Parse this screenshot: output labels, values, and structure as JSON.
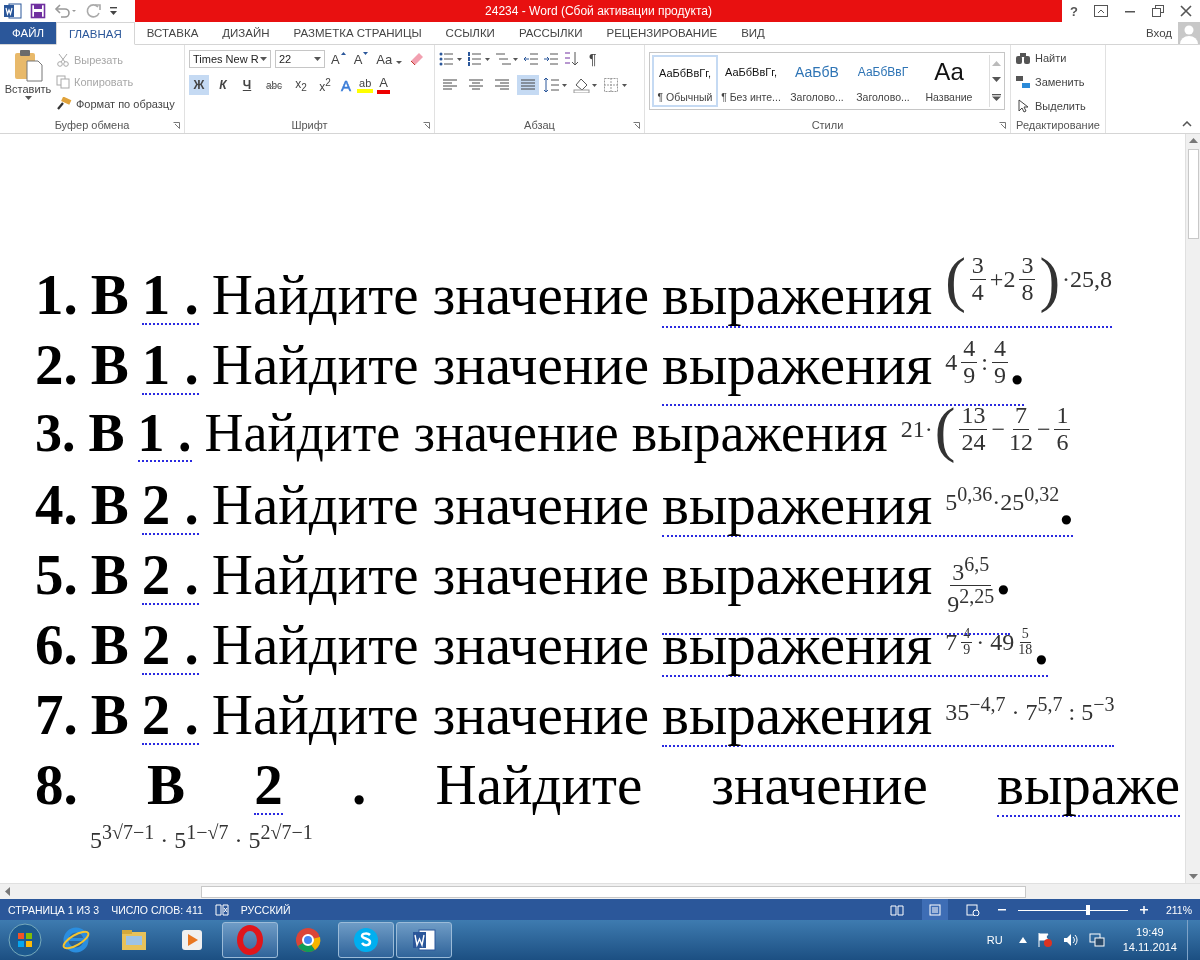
{
  "title_bar": {
    "title": "24234 -  Word (Сбой активации продукта)",
    "help": "?"
  },
  "tabs": [
    {
      "label": "ФАЙЛ",
      "kind": "file",
      "selected": false
    },
    {
      "label": "ГЛАВНАЯ",
      "kind": "tab",
      "selected": true
    },
    {
      "label": "ВСТАВКА",
      "kind": "tab",
      "selected": false
    },
    {
      "label": "ДИЗАЙН",
      "kind": "tab",
      "selected": false
    },
    {
      "label": "РАЗМЕТКА СТРАНИЦЫ",
      "kind": "tab",
      "selected": false
    },
    {
      "label": "ССЫЛКИ",
      "kind": "tab",
      "selected": false
    },
    {
      "label": "РАССЫЛКИ",
      "kind": "tab",
      "selected": false
    },
    {
      "label": "РЕЦЕНЗИРОВАНИЕ",
      "kind": "tab",
      "selected": false
    },
    {
      "label": "ВИД",
      "kind": "tab",
      "selected": false
    }
  ],
  "account": "Вход",
  "ribbon": {
    "clipboard": {
      "paste": "Вставить",
      "items": [
        {
          "label": "Вырезать",
          "disabled": true
        },
        {
          "label": "Копировать",
          "disabled": true
        },
        {
          "label": "Формат по образцу",
          "disabled": false
        }
      ],
      "label": "Буфер обмена"
    },
    "font": {
      "family": "Times New R",
      "size": "22",
      "grow": "A",
      "shrink": "A",
      "case": "Aa",
      "buttons": [
        {
          "text": "Ж",
          "kind": "bold",
          "selected": true
        },
        {
          "text": "К",
          "kind": "italic",
          "selected": false
        },
        {
          "text": "Ч",
          "kind": "underline",
          "selected": false
        },
        {
          "text": "abc",
          "kind": "strike",
          "selected": false
        },
        {
          "text": "x$_{2}$",
          "kind": "sub",
          "selected": false
        },
        {
          "text": "x$^{2}$",
          "kind": "sup",
          "selected": false
        }
      ],
      "effects": "A",
      "highlight": "ab",
      "color_text": "A",
      "label": "Шрифт"
    },
    "paragraph": {
      "pilcrow": "¶",
      "align": [
        {
          "kind": "left",
          "selected": false
        },
        {
          "kind": "center",
          "selected": false
        },
        {
          "kind": "right",
          "selected": false
        },
        {
          "kind": "justify",
          "selected": true
        }
      ],
      "label": "Абзац"
    },
    "styles": {
      "items": [
        {
          "sample": "АаБбВвГг,",
          "name": "¶ Обычный",
          "kind": "normal",
          "selected": true
        },
        {
          "sample": "АаБбВвГг,",
          "name": "¶ Без инте...",
          "kind": "normal",
          "selected": false
        },
        {
          "sample": "АаБбВ",
          "name": "Заголово...",
          "kind": "heading1",
          "selected": false
        },
        {
          "sample": "АаБбВвГ",
          "name": "Заголово...",
          "kind": "heading2",
          "selected": false
        },
        {
          "sample": "Аа",
          "name": "Название",
          "kind": "title",
          "selected": false
        }
      ],
      "label": "Стили"
    },
    "editing": {
      "items": [
        {
          "label": "Найти",
          "kind": "find"
        },
        {
          "label": "Заменить",
          "kind": "replace"
        },
        {
          "label": "Выделить",
          "kind": "select"
        }
      ],
      "label": "Редактирование"
    }
  },
  "document": {
    "items": [
      {
        "kind": "line",
        "number": "1.",
        "letter": "В",
        "task": "1",
        "dot": ".",
        "phrase": "Найдите значение",
        "word": "выражения",
        "flagged": true,
        "expr": [
          {
            "kind": "paren",
            "text": "("
          },
          {
            "kind": "frac",
            "num": "3",
            "den": "4"
          },
          {
            "kind": "text",
            "text": "+2"
          },
          {
            "kind": "frac",
            "num": "3",
            "den": "8"
          },
          {
            "kind": "paren",
            "text": ")"
          },
          {
            "kind": "text",
            "text": "·25,8"
          }
        ]
      },
      {
        "kind": "line",
        "number": "2.",
        "letter": "В",
        "task": "1",
        "dot": ".",
        "phrase": "Найдите значение",
        "word": "выражения",
        "flagged": true,
        "expr": [
          {
            "kind": "text",
            "text": "4"
          },
          {
            "kind": "frac",
            "num": "4",
            "den": "9"
          },
          {
            "kind": "text",
            "text": " : "
          },
          {
            "kind": "frac",
            "num": "4",
            "den": "9"
          }
        ],
        "end": "."
      },
      {
        "kind": "line",
        "number": "3.",
        "letter": "В",
        "task": "1",
        "dot": ".",
        "phrase": "Найдите значение",
        "word": "выражения",
        "flagged": false,
        "expr": [
          {
            "kind": "text",
            "text": "21·"
          },
          {
            "kind": "paren",
            "text": "("
          },
          {
            "kind": "frac",
            "num": "13",
            "den": "24"
          },
          {
            "kind": "text",
            "text": " − "
          },
          {
            "kind": "frac",
            "num": "7",
            "den": "12"
          },
          {
            "kind": "text",
            "text": " − "
          },
          {
            "kind": "frac",
            "num": "1",
            "den": "6"
          }
        ]
      },
      {
        "kind": "line",
        "number": "4.",
        "letter": "В",
        "task": "2",
        "dot": ".",
        "phrase": "Найдите значение",
        "word": "выражения",
        "flagged": true,
        "expr": [
          {
            "kind": "text",
            "text": "5$^{0,36}$·25$^{0,32}$"
          }
        ],
        "end": "."
      },
      {
        "kind": "line",
        "number": "5.",
        "letter": "В",
        "task": "2",
        "dot": ".",
        "phrase": "Найдите значение",
        "word": "выражения",
        "flagged": true,
        "expr": [
          {
            "kind": "frac",
            "num": "3$^{6,5}$",
            "den": "9$^{2,25}$"
          }
        ],
        "end": "."
      },
      {
        "kind": "line",
        "number": "6.",
        "letter": "В",
        "task": "2",
        "dot": ".",
        "phrase": "Найдите значение",
        "word": "выражения",
        "flagged": true,
        "expr": [
          {
            "kind": "text",
            "text": "7"
          },
          {
            "kind": "supfrac",
            "num": "4",
            "den": "9"
          },
          {
            "kind": "text",
            "text": " · 49"
          },
          {
            "kind": "supfrac",
            "num": "5",
            "den": "18"
          }
        ],
        "end": "."
      },
      {
        "kind": "line",
        "number": "7.",
        "letter": "В",
        "task": "2",
        "dot": ".",
        "phrase": "Найдите значение",
        "word": "выражения",
        "flagged": true,
        "expr": [
          {
            "kind": "text",
            "text": "35$^{−4,7}$ · 7$^{5,7}$ : 5$^{−3}$"
          }
        ]
      },
      {
        "kind": "justified",
        "number": "8.",
        "letter": "В",
        "task": "2",
        "dot": ".",
        "phrase": "Найдите значение",
        "word": "выраже",
        "flagged": true,
        "expr": [
          {
            "kind": "text",
            "text": "5$^{3√7−1}$ · 5$^{1−√7}$ · 5$^{2√7−1}$"
          }
        ]
      }
    ]
  },
  "status_bar": {
    "page": "СТРАНИЦА 1 ИЗ 3",
    "words": "ЧИСЛО СЛОВ: 411",
    "language": "РУССКИЙ",
    "views": [
      {
        "kind": "read",
        "selected": false
      },
      {
        "kind": "print",
        "selected": true
      },
      {
        "kind": "web",
        "selected": false
      }
    ],
    "zoom": {
      "level": 0.64
    },
    "zoom_text": "211%"
  },
  "taskbar": {
    "apps": [
      {
        "kind": "ie",
        "running": false
      },
      {
        "kind": "folder",
        "running": false
      },
      {
        "kind": "media",
        "running": false
      },
      {
        "kind": "opera",
        "running": true
      },
      {
        "kind": "chrome",
        "running": false
      },
      {
        "kind": "skype",
        "running": true
      },
      {
        "kind": "word",
        "running": true
      }
    ],
    "language": "RU",
    "time": "19:49",
    "date": "14.11.2014"
  }
}
